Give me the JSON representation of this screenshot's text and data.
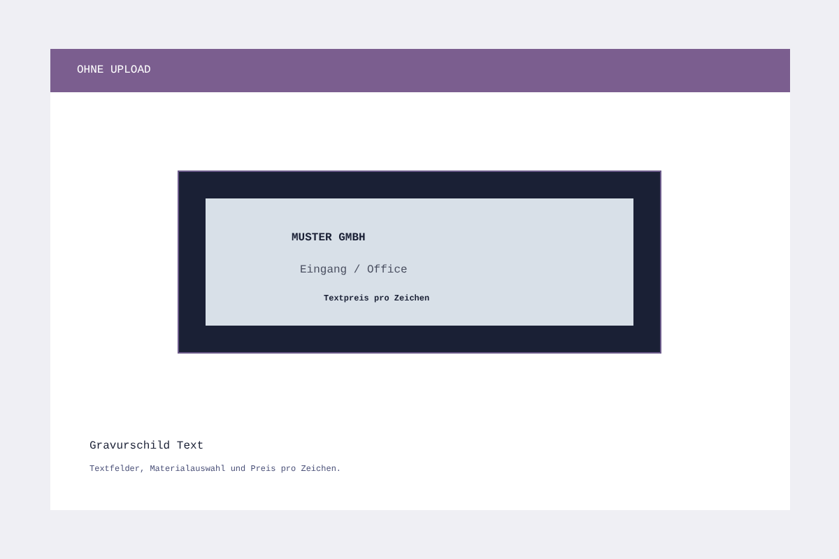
{
  "header": {
    "title": "OHNE UPLOAD"
  },
  "sign": {
    "lines": [
      {
        "kind": "title",
        "text": "MUSTER GMBH"
      },
      {
        "kind": "subtitle",
        "text": "Eingang / Office"
      },
      {
        "kind": "note",
        "text": "Textpreis pro Zeichen"
      }
    ]
  },
  "caption": {
    "title": "Gravurschild Text",
    "description": "Textfelder, Materialauswahl und Preis pro Zeichen."
  }
}
